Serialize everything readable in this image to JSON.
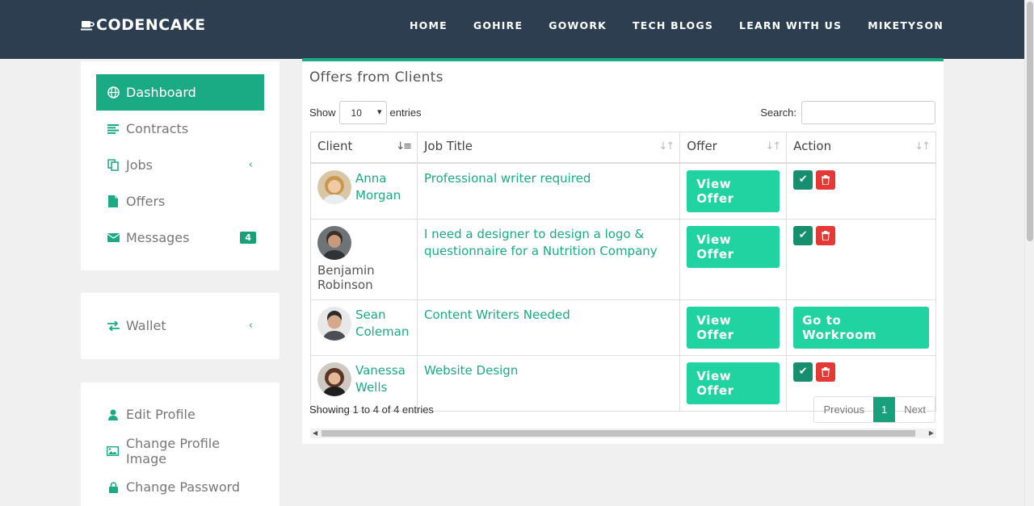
{
  "brand": "CODENCAKE",
  "nav": [
    "HOME",
    "GOHIRE",
    "GOWORK",
    "TECH BLOGS",
    "LEARN WITH US",
    "MIKETYSON"
  ],
  "sidebar": {
    "main": [
      {
        "label": "Dashboard",
        "icon": "globe-icon",
        "active": true
      },
      {
        "label": "Contracts",
        "icon": "list-icon"
      },
      {
        "label": "Jobs",
        "icon": "copy-icon"
      },
      {
        "label": "Offers",
        "icon": "file-icon"
      },
      {
        "label": "Messages",
        "icon": "envelope-icon",
        "badge": "4"
      }
    ],
    "wallet": {
      "label": "Wallet",
      "icon": "exchange-icon"
    },
    "profile": [
      {
        "label": "Edit Profile",
        "icon": "user-icon"
      },
      {
        "label": "Change Profile Image",
        "icon": "image-icon"
      },
      {
        "label": "Change Password",
        "icon": "lock-icon"
      }
    ]
  },
  "panel": {
    "title": "Offers from Clients",
    "show_label": "Show",
    "entries_value": "10",
    "entries_label": "entries",
    "search_label": "Search:",
    "columns": [
      "Client",
      "Job Title",
      "Offer",
      "Action"
    ],
    "rows": [
      {
        "client": "Anna Morgan",
        "job": "Professional writer required",
        "offer": "View Offer",
        "action": "icons"
      },
      {
        "client": "Benjamin Robinson",
        "job": "I need a designer to design a logo & questionnaire for a Nutrition Company",
        "offer": "View Offer",
        "action": "icons"
      },
      {
        "client": "Sean Coleman",
        "job": "Content Writers Needed",
        "offer": "View Offer",
        "action": "Go to Workroom"
      },
      {
        "client": "Vanessa Wells",
        "job": "Website Design",
        "offer": "View Offer",
        "action": "icons"
      }
    ],
    "info": "Showing 1 to 4 of 4 entries",
    "pager": {
      "prev": "Previous",
      "current": "1",
      "next": "Next"
    }
  },
  "colors": {
    "navbar": "#2c3e50",
    "accent": "#1aab84",
    "button": "#20d3a0",
    "danger": "#e53935"
  }
}
